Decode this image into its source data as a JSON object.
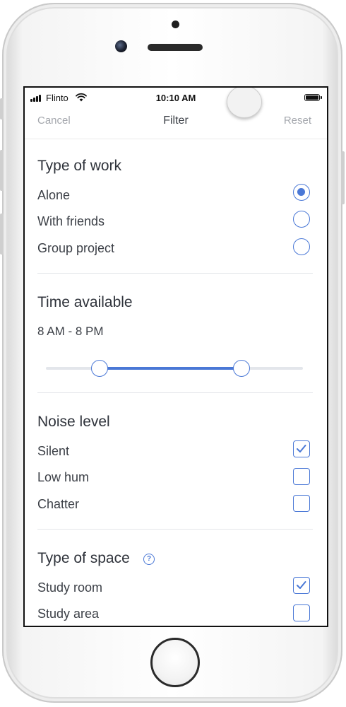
{
  "status_bar": {
    "carrier": "Flinto",
    "time": "10:10 AM"
  },
  "nav": {
    "cancel": "Cancel",
    "title": "Filter",
    "reset": "Reset"
  },
  "type_of_work": {
    "title": "Type of work",
    "options": [
      {
        "label": "Alone",
        "selected": true
      },
      {
        "label": "With friends",
        "selected": false
      },
      {
        "label": "Group project",
        "selected": false
      }
    ]
  },
  "time_available": {
    "title": "Time available",
    "range_text": "8 AM - 8 PM",
    "slider": {
      "low": 0.21,
      "high": 0.76
    }
  },
  "noise_level": {
    "title": "Noise level",
    "options": [
      {
        "label": "Silent",
        "checked": true
      },
      {
        "label": "Low hum",
        "checked": false
      },
      {
        "label": "Chatter",
        "checked": false
      }
    ]
  },
  "type_of_space": {
    "title": "Type of space",
    "help_icon": "question-circle-icon",
    "help_glyph": "?",
    "options": [
      {
        "label": "Study room",
        "checked": true
      },
      {
        "label": "Study area",
        "checked": false
      }
    ]
  },
  "colors": {
    "accent": "#4a78d6",
    "muted_text": "#a4a7ad",
    "body_text": "#3b3f46"
  }
}
